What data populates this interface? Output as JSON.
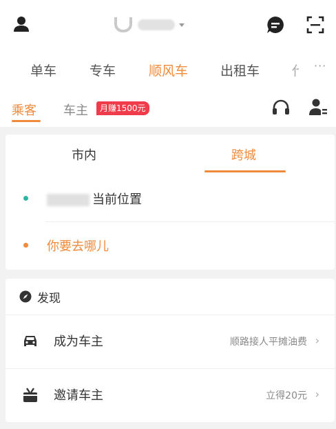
{
  "header": {
    "user_icon": "user-icon",
    "logo_icon": "didi-logo-icon",
    "message_icon": "message-icon",
    "scan_icon": "scan-icon"
  },
  "modes": {
    "items": [
      "单车",
      "专车",
      "顺风车",
      "出租车",
      "代"
    ],
    "active": "顺风车",
    "more_label": "···"
  },
  "roles": {
    "passenger": "乘客",
    "driver": "车主",
    "badge": "月赚1500元",
    "headset_icon": "headset-icon",
    "driver_icon": "driver-profile-icon"
  },
  "ride": {
    "tabs": [
      "市内",
      "跨城"
    ],
    "active_tab": "跨城",
    "current_location": "当前位置",
    "destination_placeholder": "你要去哪儿",
    "colors": {
      "accent": "#f08a3c",
      "origin_dot": "#2bb5a0"
    }
  },
  "discover": {
    "label": "发现",
    "items": [
      {
        "title": "成为车主",
        "sub": "顺路接人平摊油费",
        "icon": "car-icon"
      },
      {
        "title": "邀请车主",
        "sub": "立得20元",
        "icon": "gift-icon"
      }
    ]
  }
}
